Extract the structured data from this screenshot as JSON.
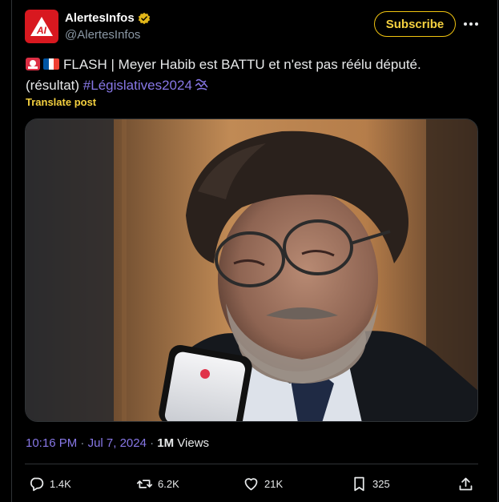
{
  "author": {
    "name": "AlertesInfos",
    "handle": "@AlertesInfos",
    "avatar_text": "AI",
    "verified": true
  },
  "header": {
    "subscribe_label": "Subscribe"
  },
  "post": {
    "main_text": "FLASH | Meyer Habib est BATTU et n'est pas réélu député.",
    "line2_prefix": "(résultat) ",
    "hashtag": "#Législatives2024",
    "translate_label": "Translate post",
    "time": "10:16 PM",
    "separator": " · ",
    "date": "Jul 7, 2024",
    "views_count": "1M",
    "views_label": " Views"
  },
  "actions": {
    "replies": "1.4K",
    "reposts": "6.2K",
    "likes": "21K",
    "bookmarks": "325"
  },
  "icons": [
    "siren-emoji-icon",
    "france-flag-icon",
    "verified-badge-icon",
    "more-icon",
    "reply-icon",
    "repost-icon",
    "like-icon",
    "bookmark-icon",
    "share-icon"
  ],
  "colors": {
    "background": "#000000",
    "hashtag": "#8777e6",
    "translate": "#f4d03f",
    "subscribe_border": "#f1c40f",
    "avatar": "#d8181f",
    "muted": "#8b98a5"
  }
}
